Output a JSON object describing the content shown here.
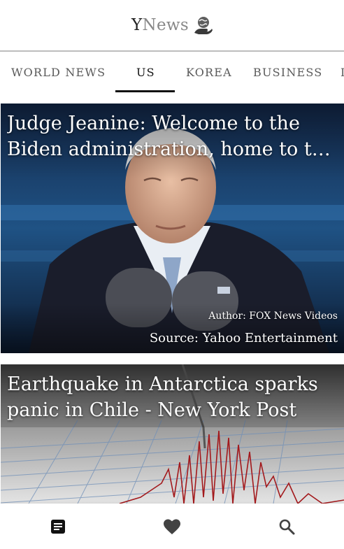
{
  "header": {
    "brand_prefix": "Y",
    "brand_suffix": "News",
    "logo_icon": "globe-hand-icon"
  },
  "tabs": [
    {
      "label": "WORLD NEWS",
      "active": false
    },
    {
      "label": "US",
      "active": true
    },
    {
      "label": "KOREA",
      "active": false
    },
    {
      "label": "BUSINESS",
      "active": false
    }
  ],
  "articles": [
    {
      "headline": "Judge Jeanine: Welcome to the Biden administration, home to the …",
      "author": "Author: FOX News Videos",
      "source": "Source: Yahoo Entertainment"
    },
    {
      "headline": "Earthquake in Antarctica sparks panic in Chile - New York Post"
    }
  ],
  "bottom_nav": [
    {
      "icon": "article-icon",
      "active": true
    },
    {
      "icon": "heart-icon",
      "active": false
    },
    {
      "icon": "search-icon",
      "active": false
    }
  ],
  "colors": {
    "text_dark": "#111111",
    "tab_inactive": "#5a5a5a",
    "nav_icon": "#424242"
  }
}
